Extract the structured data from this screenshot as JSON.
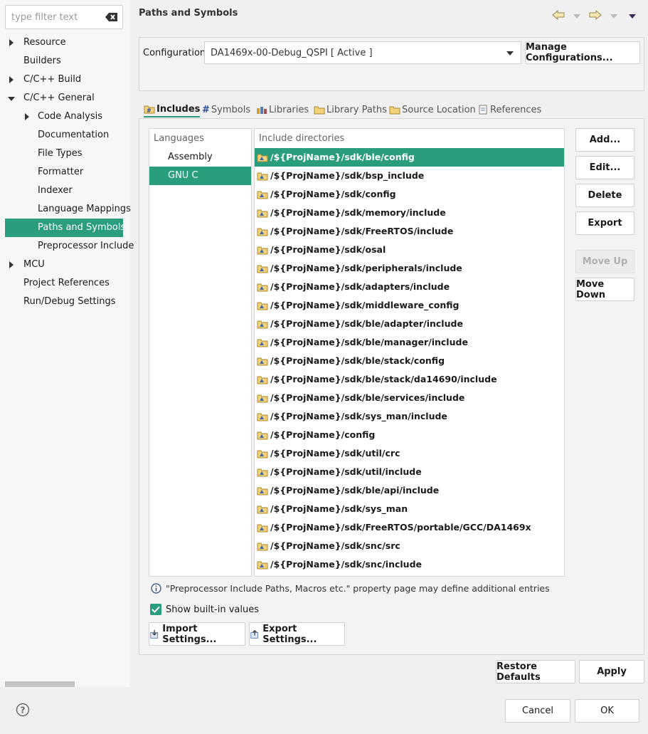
{
  "sidebar": {
    "filter_placeholder": "type filter text",
    "items": [
      {
        "label": "Resource",
        "expand": "collapsed",
        "indent": 0
      },
      {
        "label": "Builders",
        "expand": "none",
        "indent": 0
      },
      {
        "label": "C/C++ Build",
        "expand": "collapsed",
        "indent": 0
      },
      {
        "label": "C/C++ General",
        "expand": "expanded",
        "indent": 0
      },
      {
        "label": "Code Analysis",
        "expand": "collapsed",
        "indent": 1
      },
      {
        "label": "Documentation",
        "expand": "none",
        "indent": 1
      },
      {
        "label": "File Types",
        "expand": "none",
        "indent": 1
      },
      {
        "label": "Formatter",
        "expand": "none",
        "indent": 1
      },
      {
        "label": "Indexer",
        "expand": "none",
        "indent": 1
      },
      {
        "label": "Language Mappings",
        "expand": "none",
        "indent": 1
      },
      {
        "label": "Paths and Symbols",
        "expand": "none",
        "indent": 1,
        "selected": true
      },
      {
        "label": "Preprocessor Include",
        "expand": "none",
        "indent": 1
      },
      {
        "label": "MCU",
        "expand": "collapsed",
        "indent": 0
      },
      {
        "label": "Project References",
        "expand": "none",
        "indent": 0
      },
      {
        "label": "Run/Debug Settings",
        "expand": "none",
        "indent": 0
      }
    ]
  },
  "header": {
    "title": "Paths and Symbols"
  },
  "configuration": {
    "label": "Configuration:",
    "value": "DA1469x-00-Debug_QSPI  [ Active ]",
    "manage_button": "Manage Configurations..."
  },
  "tabs": [
    {
      "label": "Includes",
      "icon": "includes-icon",
      "active": true
    },
    {
      "label": "Symbols",
      "icon": "hash-icon"
    },
    {
      "label": "Libraries",
      "icon": "libraries-icon"
    },
    {
      "label": "Library Paths",
      "icon": "folder-icon"
    },
    {
      "label": "Source Location",
      "icon": "folder-icon"
    },
    {
      "label": "References",
      "icon": "references-icon"
    }
  ],
  "languages": {
    "header": "Languages",
    "items": [
      {
        "label": "Assembly"
      },
      {
        "label": "GNU C",
        "selected": true
      }
    ]
  },
  "includes": {
    "header": "Include directories",
    "items": [
      "/${ProjName}/sdk/ble/config",
      "/${ProjName}/sdk/bsp_include",
      "/${ProjName}/sdk/config",
      "/${ProjName}/sdk/memory/include",
      "/${ProjName}/sdk/FreeRTOS/include",
      "/${ProjName}/sdk/osal",
      "/${ProjName}/sdk/peripherals/include",
      "/${ProjName}/sdk/adapters/include",
      "/${ProjName}/sdk/middleware_config",
      "/${ProjName}/sdk/ble/adapter/include",
      "/${ProjName}/sdk/ble/manager/include",
      "/${ProjName}/sdk/ble/stack/config",
      "/${ProjName}/sdk/ble/stack/da14690/include",
      "/${ProjName}/sdk/ble/services/include",
      "/${ProjName}/sdk/sys_man/include",
      "/${ProjName}/config",
      "/${ProjName}/sdk/util/crc",
      "/${ProjName}/sdk/util/include",
      "/${ProjName}/sdk/ble/api/include",
      "/${ProjName}/sdk/sys_man",
      "/${ProjName}/sdk/FreeRTOS/portable/GCC/DA1469x",
      "/${ProjName}/sdk/snc/src",
      "/${ProjName}/sdk/snc/include"
    ],
    "selected_index": 0
  },
  "side_buttons": {
    "add": "Add...",
    "edit": "Edit...",
    "delete": "Delete",
    "export": "Export",
    "move_up": "Move Up",
    "move_down": "Move Down"
  },
  "info_text": "\"Preprocessor Include Paths, Macros etc.\" property page may define additional entries",
  "show_builtin": {
    "label": "Show built-in values",
    "checked": true
  },
  "import_settings": "Import Settings...",
  "export_settings": "Export Settings...",
  "restore_defaults": "Restore Defaults",
  "apply": "Apply",
  "cancel": "Cancel",
  "ok": "OK",
  "colors": {
    "accent": "#2a9d7f"
  }
}
